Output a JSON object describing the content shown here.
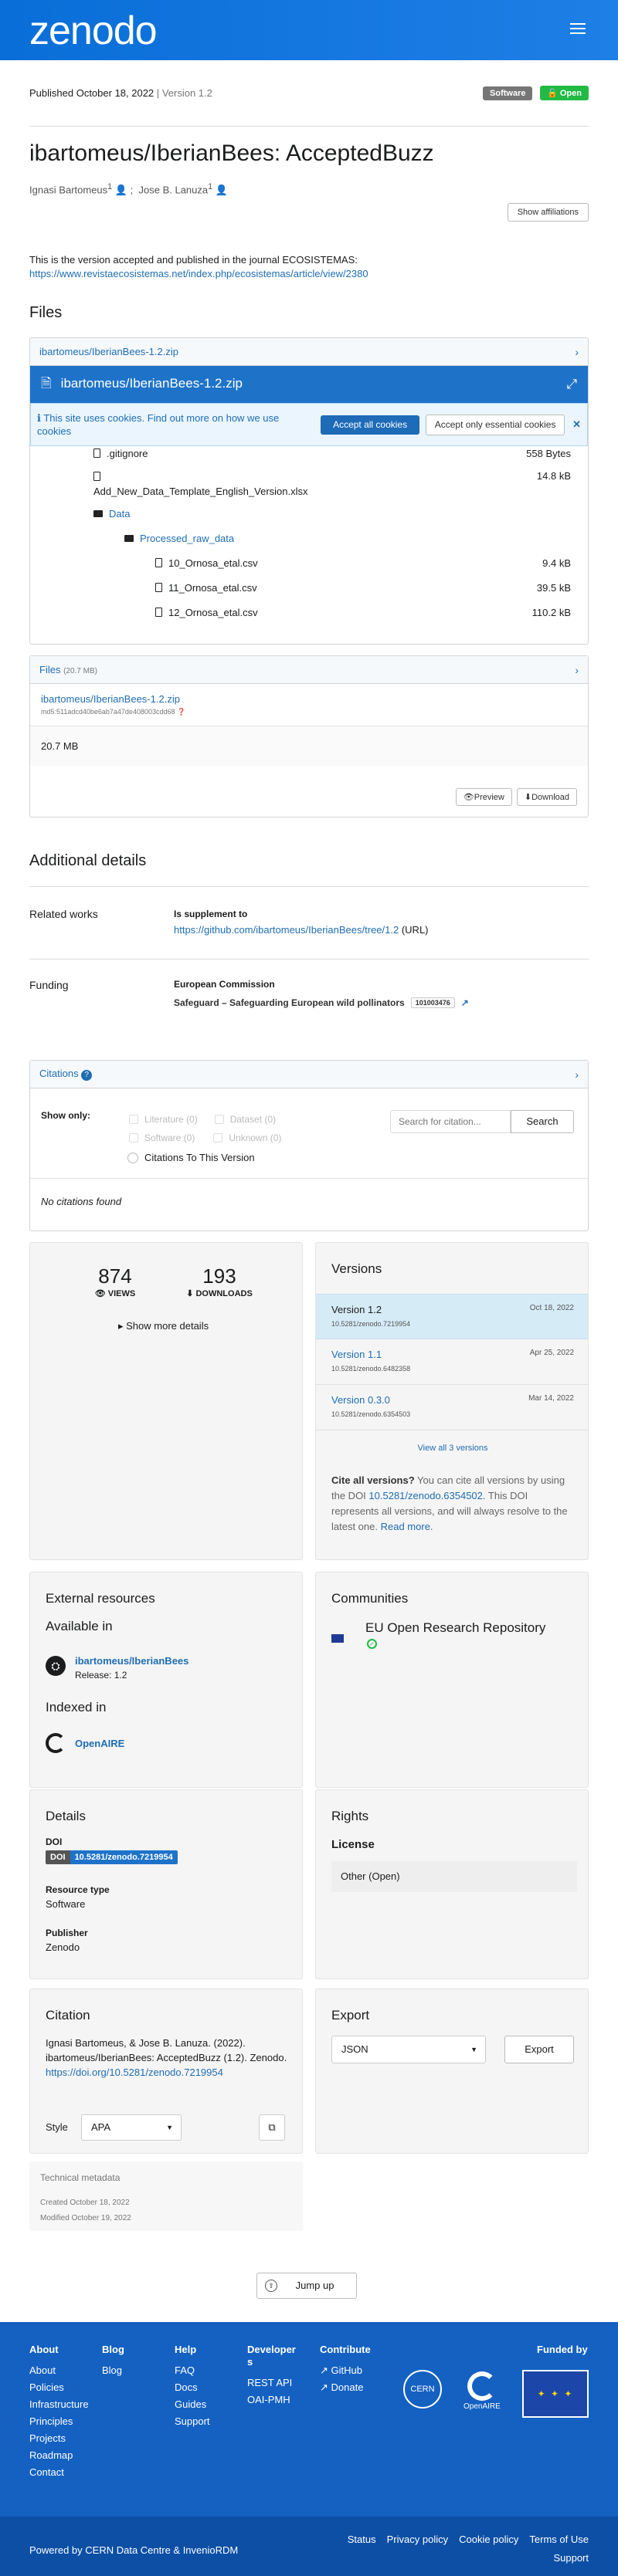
{
  "header": {
    "logo": "zenodo"
  },
  "record": {
    "published": "Published October 18, 2022",
    "version_sep": "|",
    "version": "Version 1.2",
    "type_badge": "Software",
    "access_badge": "Open",
    "title": "ibartomeus/IberianBees: AcceptedBuzz",
    "creators": [
      {
        "name": "Ignasi Bartomeus",
        "sup": "1"
      },
      {
        "name": "Jose B. Lanuza",
        "sup": "1"
      }
    ],
    "creators_sep": ";",
    "show_affiliations": "Show affiliations",
    "description": "This is the version accepted and published in the journal ECOSISTEMAS:",
    "description_link": "https://www.revistaecosistemas.net/index.php/ecosistemas/article/view/2380"
  },
  "files_section": {
    "heading": "Files",
    "accordion_title": "ibartomeus/IberianBees-1.2.zip",
    "preview_title": "ibartomeus/IberianBees-1.2.zip",
    "cookie_text": "This site uses cookies. Find out more on how we use cookies",
    "cookie_accept": "Accept all cookies",
    "cookie_essential": "Accept only essential cookies",
    "tree": [
      {
        "name": ".gitignore",
        "size": "558 Bytes",
        "kind": "file",
        "level": 0
      },
      {
        "name": "Add_New_Data_Template_English_Version.xlsx",
        "size": "14.8 kB",
        "kind": "file",
        "level": 0
      },
      {
        "name": "Data",
        "size": "",
        "kind": "folder",
        "level": 0
      },
      {
        "name": "Processed_raw_data",
        "size": "",
        "kind": "folder",
        "level": 1
      },
      {
        "name": "10_Ornosa_etal.csv",
        "size": "9.4 kB",
        "kind": "file",
        "level": 2
      },
      {
        "name": "11_Ornosa_etal.csv",
        "size": "39.5 kB",
        "kind": "file",
        "level": 2
      },
      {
        "name": "12_Ornosa_etal.csv",
        "size": "110.2 kB",
        "kind": "file",
        "level": 2
      }
    ],
    "files_label": "Files",
    "files_total": "(20.7 MB)",
    "file_name": "ibartomeus/IberianBees-1.2.zip",
    "md5": "md5:511adcd40be6ab7a47de408003cdd68",
    "file_size": "20.7 MB",
    "preview_btn": "Preview",
    "download_btn": "Download"
  },
  "additional": {
    "heading": "Additional details",
    "related_label": "Related works",
    "related_relation": "Is supplement to",
    "related_link": "https://github.com/ibartomeus/IberianBees/tree/1.2",
    "related_scheme": "(URL)",
    "funding_label": "Funding",
    "funder": "European Commission",
    "award": "Safeguard – Safeguarding European wild pollinators",
    "award_number": "101003476"
  },
  "citations": {
    "title": "Citations",
    "show_only": "Show only:",
    "filters": [
      "Literature (0)",
      "Dataset (0)",
      "Software (0)",
      "Unknown (0)"
    ],
    "this_version": "Citations To This Version",
    "search_placeholder": "Search for citation...",
    "search_btn": "Search",
    "empty": "No citations found"
  },
  "stats": {
    "views": "874",
    "views_label": "VIEWS",
    "downloads": "193",
    "downloads_label": "DOWNLOADS",
    "more": "Show more details"
  },
  "versions": {
    "title": "Versions",
    "items": [
      {
        "label": "Version 1.2",
        "doi": "10.5281/zenodo.7219954",
        "date": "Oct 18, 2022"
      },
      {
        "label": "Version 1.1",
        "doi": "10.5281/zenodo.6482358",
        "date": "Apr 25, 2022"
      },
      {
        "label": "Version 0.3.0",
        "doi": "10.5281/zenodo.6354503",
        "date": "Mar 14, 2022"
      }
    ],
    "view_all": "View all 3 versions",
    "cite_all_bold": "Cite all versions?",
    "cite_all_pre": " You can cite all versions by using the DOI ",
    "cite_all_doi": "10.5281/zenodo.6354502",
    "cite_all_post": ". This DOI represents all versions, and will always resolve to the latest one. ",
    "read_more": "Read more."
  },
  "external": {
    "title": "External resources",
    "available_in": "Available in",
    "gh_name": "ibartomeus/IberianBees",
    "gh_release": "Release: 1.2",
    "indexed_in": "Indexed in",
    "openaire": "OpenAIRE"
  },
  "communities": {
    "title": "Communities",
    "name": "EU Open Research Repository"
  },
  "details": {
    "title": "Details",
    "doi_label": "DOI",
    "doi_prefix": "DOI",
    "doi_value": "10.5281/zenodo.7219954",
    "rtype_label": "Resource type",
    "rtype_value": "Software",
    "publisher_label": "Publisher",
    "publisher_value": "Zenodo"
  },
  "rights": {
    "title": "Rights",
    "license_label": "License",
    "license_value": "Other (Open)"
  },
  "citation": {
    "title": "Citation",
    "text": "Ignasi Bartomeus, & Jose B. Lanuza. (2022). ibartomeus/IberianBees: AcceptedBuzz (1.2). Zenodo. ",
    "link": "https://doi.org/10.5281/zenodo.7219954",
    "style_label": "Style",
    "style_value": "APA"
  },
  "export": {
    "title": "Export",
    "format": "JSON",
    "btn": "Export"
  },
  "technical": {
    "title": "Technical metadata",
    "created": "Created October 18, 2022",
    "modified": "Modified October 19, 2022"
  },
  "jump_up": "Jump up",
  "footer": {
    "about": {
      "title": "About",
      "links": [
        "About",
        "Policies",
        "Infrastructure",
        "Principles",
        "Projects",
        "Roadmap",
        "Contact"
      ]
    },
    "blog": {
      "title": "Blog",
      "links": [
        "Blog"
      ]
    },
    "help": {
      "title": "Help",
      "links": [
        "FAQ",
        "Docs",
        "Guides",
        "Support"
      ]
    },
    "developers": {
      "title": "Developers",
      "links": [
        "REST API",
        "OAI-PMH"
      ]
    },
    "contribute": {
      "title": "Contribute",
      "links": [
        "GitHub",
        "Donate"
      ]
    },
    "funded_by": "Funded by",
    "cern": "CERN",
    "openaire": "OpenAIRE",
    "powered": "Powered by CERN Data Centre & InvenioRDM",
    "bottom_links": [
      "Status",
      "Privacy policy",
      "Cookie policy",
      "Terms of Use",
      "Support"
    ]
  },
  "colors": {
    "primary": "#1e73c9",
    "footer": "#1461c2",
    "footer_bottom": "#0d4fa5",
    "open": "#21ba45",
    "software": "#767676"
  }
}
